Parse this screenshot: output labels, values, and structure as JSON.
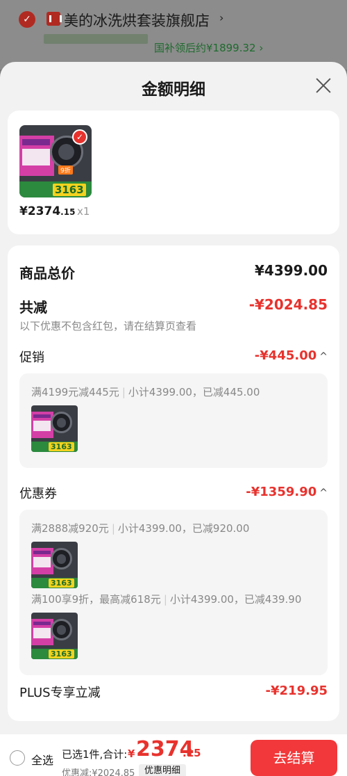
{
  "background": {
    "store_name": "美的冰洗烘套装旗舰店",
    "store_arrow": "›",
    "subsidy_text": "国补领后约¥1899.32 ›"
  },
  "sheet": {
    "title": "金额明细"
  },
  "product": {
    "price_int": "¥2374",
    "price_dec": ".15",
    "qty": "x1",
    "image_price": "3163"
  },
  "summary": {
    "total_label": "商品总价",
    "total_value": "¥4399.00",
    "reduce_label": "共减",
    "reduce_value": "-¥2024.85",
    "note": "以下优惠不包含红包，请在结算页查看"
  },
  "promotion": {
    "label": "促销",
    "value": "-¥445.00",
    "lines": [
      {
        "rule": "满4199元减445元",
        "detail": "小计4399.00，已减445.00"
      }
    ]
  },
  "coupon": {
    "label": "优惠券",
    "value": "-¥1359.90",
    "lines": [
      {
        "rule": "满2888减920元",
        "detail": "小计4399.00，已减920.00"
      },
      {
        "rule": "满100享9折，最高减618元",
        "detail": "小计4399.00，已减439.90"
      }
    ]
  },
  "plus": {
    "label": "PLUS专享立减",
    "value": "-¥219.95"
  },
  "bottom_bar": {
    "select_all": "全选",
    "selected_info": "已选1件,合计:",
    "total_yen": "¥",
    "total_int": "2374",
    "total_dec": ".15",
    "discount_info": "优惠减:¥2024.85",
    "detail_button": "优惠明细",
    "checkout_button": "去结算"
  },
  "colors": {
    "accent_red": "#e8322d",
    "checkout_red": "#f2383a"
  }
}
